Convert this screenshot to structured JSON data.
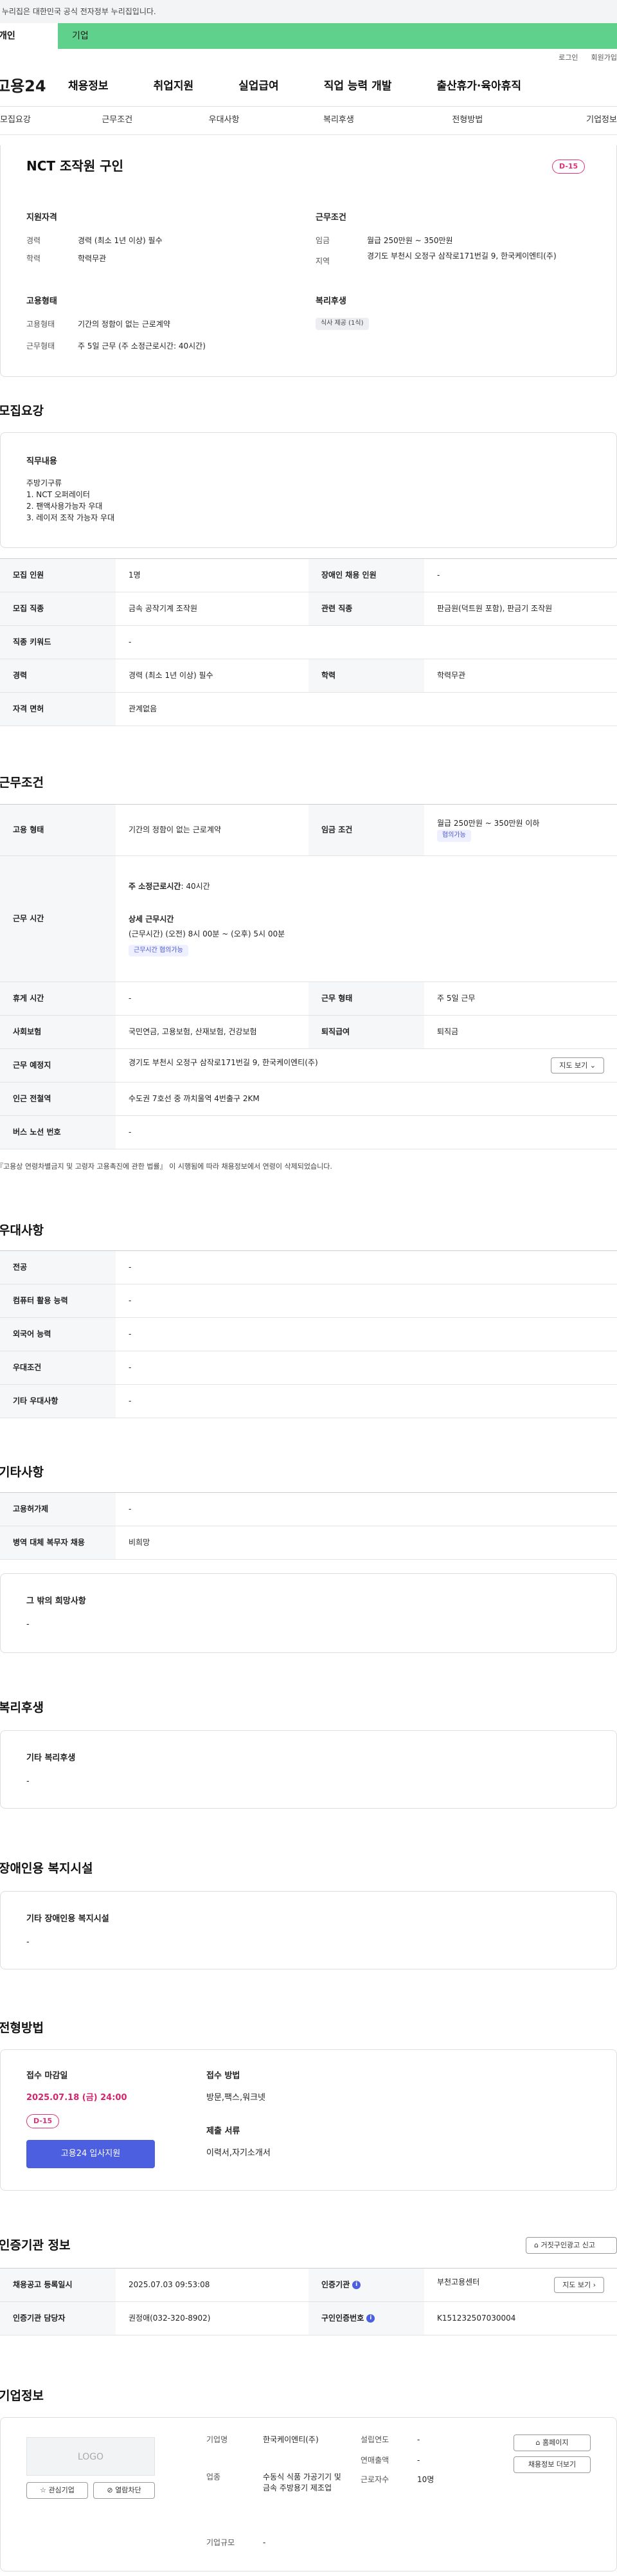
{
  "gov_bar": "이 누리집은 대한민국 공식 전자정부 누리집입니다.",
  "user_tabs": [
    "개인",
    "기업"
  ],
  "utility": {
    "login": "로그인",
    "signup": "회원가입"
  },
  "logo": "고용24",
  "gnb": [
    "채용정보",
    "취업지원",
    "실업급여",
    "직업 능력 개발",
    "출산휴가·육아휴직"
  ],
  "subnav": [
    "모집요강",
    "근무조건",
    "우대사항",
    "복리후생",
    "전형방법",
    "기업정보"
  ],
  "summary": {
    "title": "NCT 조작원 구인",
    "dday": "D-15",
    "qual_title": "지원자격",
    "qual": [
      {
        "k": "경력",
        "v": "경력 (최소 1년 이상) 필수"
      },
      {
        "k": "학력",
        "v": "학력무관"
      }
    ],
    "work_title": "근무조건",
    "work": [
      {
        "k": "임금",
        "v": "월급 250만원 ~ 350만원"
      },
      {
        "k": "지역",
        "v": "경기도 부천시 오정구 삼작로171번길 9, 한국케이엔티(주)"
      }
    ],
    "emp_title": "고용형태",
    "emp": [
      {
        "k": "고용형태",
        "v": "기간의 정함이 없는 근로계약"
      },
      {
        "k": "근무형태",
        "v": "주 5일 근무 (주 소정근로시간: 40시간)"
      }
    ],
    "welfare_title": "복리후생",
    "welfare_tag": "식사 제공 (1식)"
  },
  "recruit": {
    "title": "모집요강",
    "duty_title": "직무내용",
    "duty_lines": [
      "주방기구류",
      "1. NCT 오퍼레이터",
      "2. 팬액사용가능자 우대",
      "3. 레이저 조작 가능자 우대"
    ],
    "rows": [
      {
        "k1": "모집 인원",
        "v1": "1명",
        "k2": "장애인 채용 인원",
        "v2": "-"
      },
      {
        "k1": "모집 직종",
        "v1": "금속 공작기계 조작원",
        "k2": "관련 직종",
        "v2": "판금원(덕트원 포함), 판금기 조작원"
      },
      {
        "k1": "직종 키워드",
        "v1": "-"
      },
      {
        "k1": "경력",
        "v1": "경력 (최소 1년 이상) 필수",
        "k2": "학력",
        "v2": "학력무관"
      },
      {
        "k1": "자격 면허",
        "v1": "관계없음"
      }
    ]
  },
  "conditions": {
    "title": "근무조건",
    "emp_k": "고용 형태",
    "emp_v": "기간의 정함이 없는 근로계약",
    "wage_k": "임금 조건",
    "wage_v": "월급 250만원 ~ 350만원 이하",
    "wage_badge": "협의가능",
    "hours_k": "근무 시간",
    "hours_week_label": "주 소정근로시간",
    "hours_week_value": ": 40시간",
    "hours_detail_title": "상세 근무시간",
    "hours_detail": "(근무시간) (오전) 8시 00분 ~ (오후) 5시 00분",
    "hours_badge": "근무시간 협의가능",
    "rest_k": "휴게 시간",
    "rest_v": "-",
    "shape_k": "근무 형태",
    "shape_v": "주 5일 근무",
    "ins_k": "사회보험",
    "ins_v": "국민연금, 고용보험, 산재보험, 건강보험",
    "ret_k": "퇴직급여",
    "ret_v": "퇴직금",
    "place_k": "근무 예정지",
    "place_v": "경기도 부천시 오정구 삼작로171번길 9, 한국케이엔티(주)",
    "map_btn": "지도 보기",
    "subway_k": "인근 전철역",
    "subway_v": "수도권 7호선 중 까치울역 4번출구 2KM",
    "bus_k": "버스 노선 번호",
    "bus_v": "-",
    "note": "『고용상 연령차별금지 및 고령자 고용촉진에 관한 법률』 이 시행됨에 따라 채용정보에서 연령이 삭제되었습니다."
  },
  "preference": {
    "title": "우대사항",
    "rows": [
      {
        "k": "전공",
        "v": "-"
      },
      {
        "k": "컴퓨터 활용 능력",
        "v": "-"
      },
      {
        "k": "외국어 능력",
        "v": "-"
      },
      {
        "k": "우대조건",
        "v": "-"
      },
      {
        "k": "기타 우대사항",
        "v": "-"
      }
    ]
  },
  "etc": {
    "title": "기타사항",
    "rows": [
      {
        "k": "고용허가제",
        "v": "-"
      },
      {
        "k": "병역 대체 복무자 채용",
        "v": "비희망"
      }
    ],
    "box_title": "그 밖의 희망사항",
    "box_value": "-"
  },
  "welfare": {
    "title": "복리후생",
    "box_title": "기타 복리후생",
    "box_value": "-"
  },
  "disability": {
    "title": "장애인용 복지시설",
    "box_title": "기타 장애인용 복지시설",
    "box_value": "-"
  },
  "process": {
    "title": "전형방법",
    "deadline_label": "접수 마감일",
    "deadline": "2025.07.18 (금) 24:00",
    "dday": "D-15",
    "apply_btn": "고용24 입사지원",
    "method_label": "접수 방법",
    "method": "방문,팩스,워크넷",
    "docs_label": "제출 서류",
    "docs": "이력서,자기소개서"
  },
  "agency": {
    "title": "인증기관 정보",
    "report_btn": "거짓구인광고 신고",
    "reg_k": "채용공고 등록일시",
    "reg_v": "2025.07.03 09:53:08",
    "org_k": "인증기관",
    "org_v": "부천고용센터",
    "map_btn": "지도 보기",
    "mgr_k": "인증기관 담당자",
    "mgr_v": "권정애(032-320-8902)",
    "no_k": "구인인증번호",
    "no_v": "K151232507030004"
  },
  "company": {
    "title": "기업정보",
    "logo": "LOGO",
    "fav_btn": "관심기업",
    "block_btn": "열람차단",
    "name_k": "기업명",
    "name_v": "한국케이엔티(주)",
    "ind_k": "업종",
    "ind_v": "수동식 식품 가공기기 및 금속 주방용기 제조업",
    "size_k": "기업규모",
    "size_v": "-",
    "est_k": "설립연도",
    "est_v": "-",
    "rev_k": "연매출액",
    "rev_v": "-",
    "emp_k": "근로자수",
    "emp_v": "10명",
    "home_btn": "홈페이지",
    "jobs_btn": "채용정보 더보기"
  }
}
